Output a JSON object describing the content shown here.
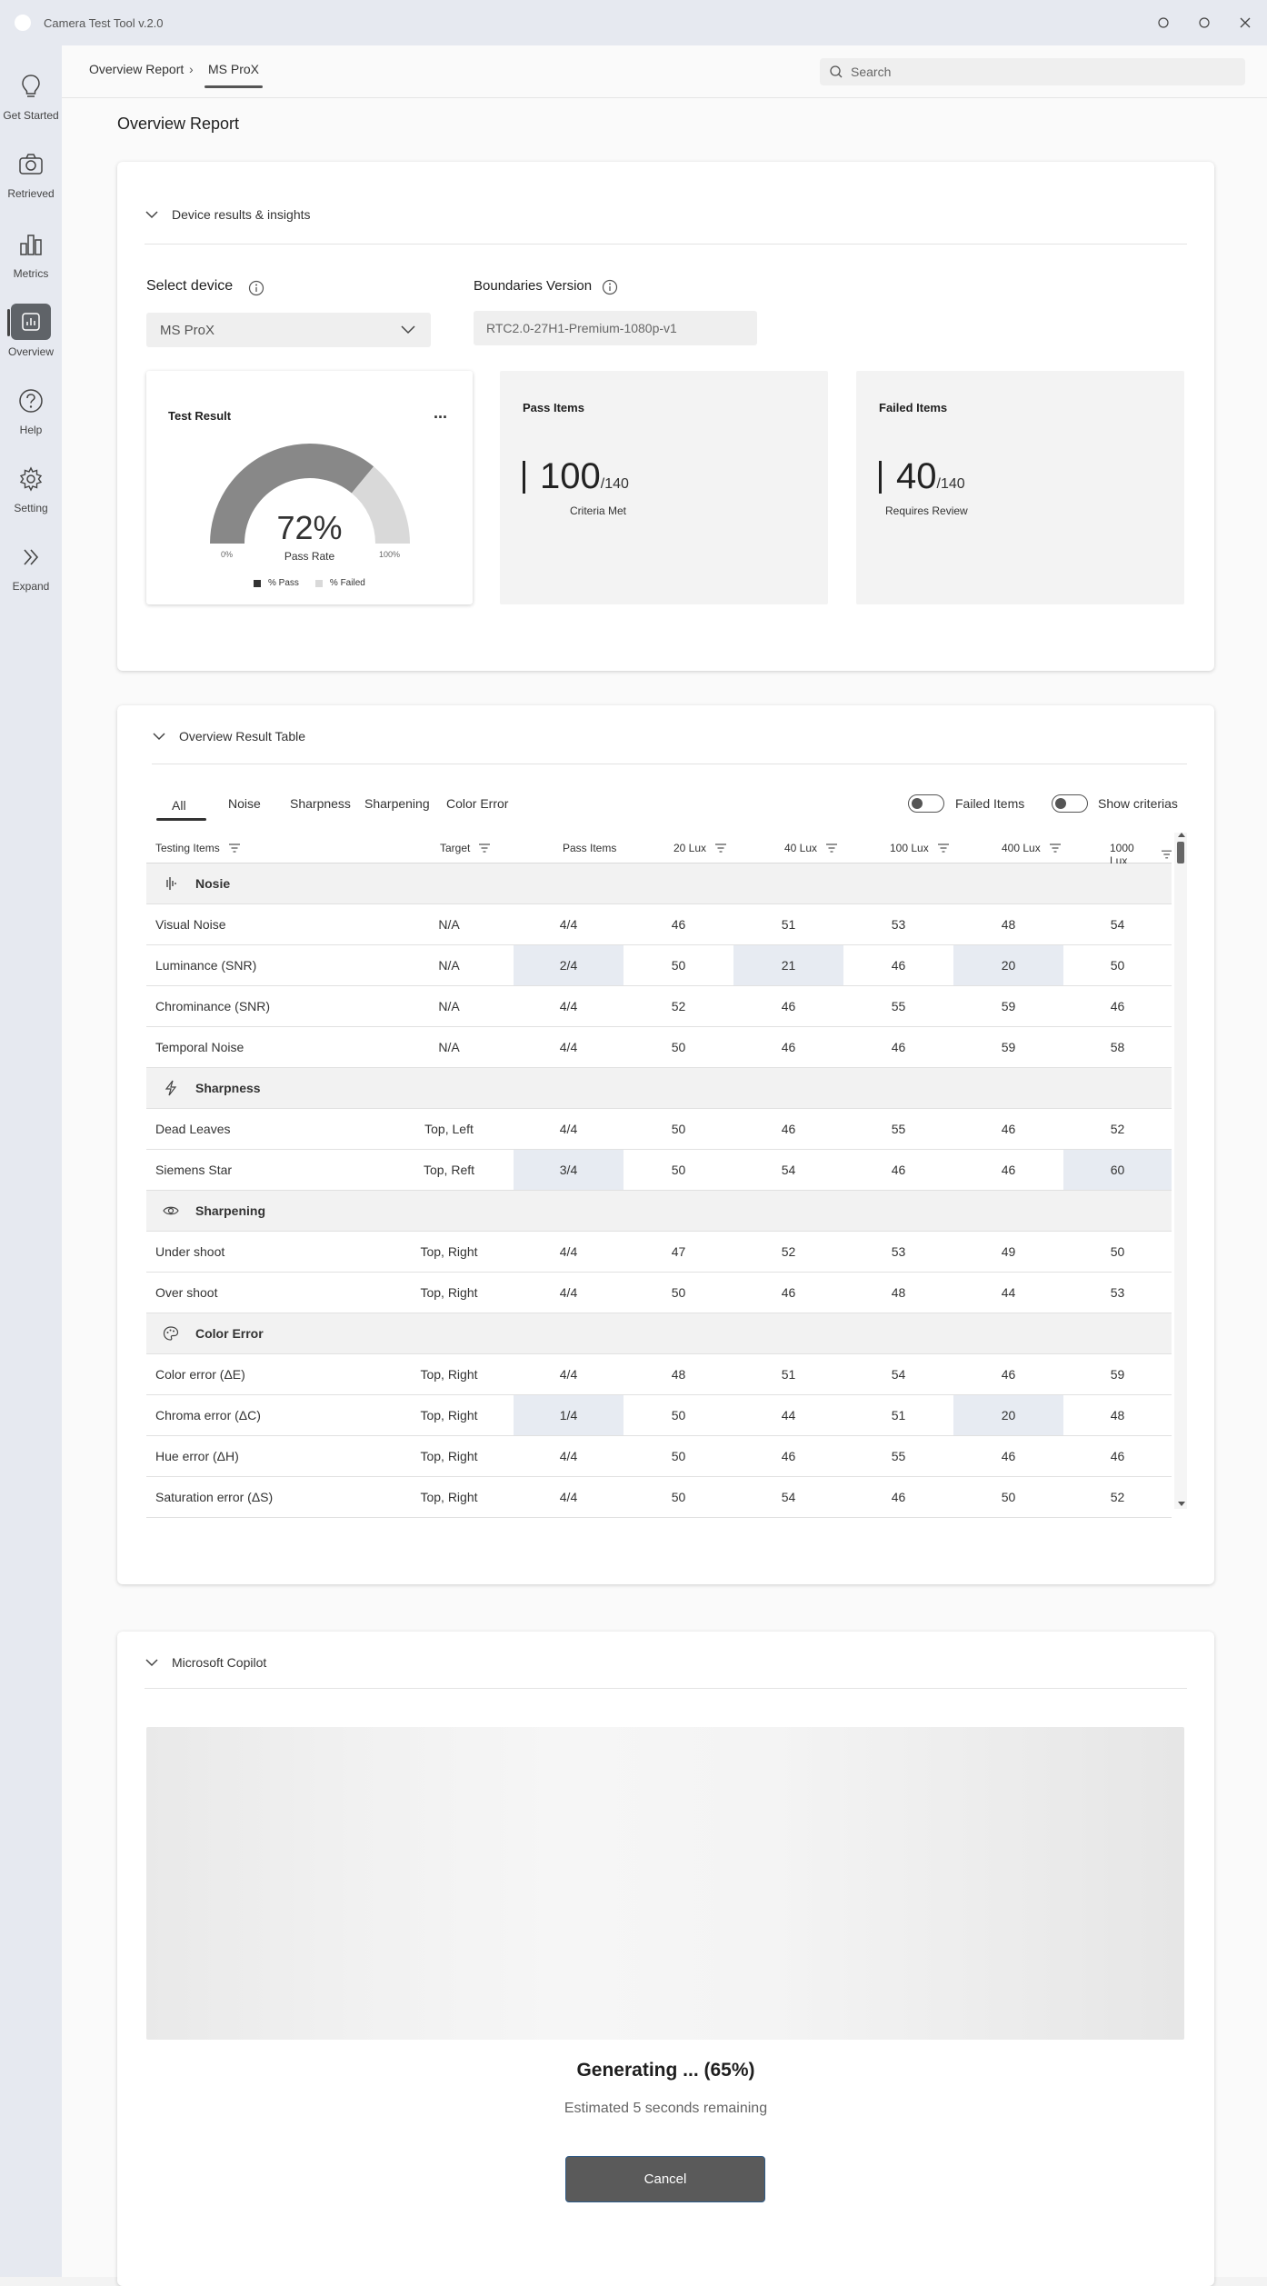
{
  "window": {
    "title": "Camera Test Tool v.2.0"
  },
  "rail": [
    {
      "label": "Get Started",
      "icon": "lightbulb-icon"
    },
    {
      "label": "Retrieved",
      "icon": "camera-icon"
    },
    {
      "label": "Metrics",
      "icon": "bar-chart-icon"
    },
    {
      "label": "Overview",
      "icon": "report-icon"
    },
    {
      "label": "Help",
      "icon": "help-icon"
    },
    {
      "label": "Setting",
      "icon": "gear-icon"
    },
    {
      "label": "Expand",
      "icon": "double-chevron-right-icon"
    }
  ],
  "rail_active": "Overview",
  "breadcrumb": {
    "root": "Overview Report",
    "current": "MS ProX"
  },
  "search": {
    "placeholder": "Search"
  },
  "page_title": "Overview Report",
  "insights": {
    "section_title": "Device results & insights",
    "select_device_label": "Select device",
    "device_value": "MS ProX",
    "boundaries_label": "Boundaries Version",
    "boundaries_value": "RTC2.0-27H1-Premium-1080p-v1",
    "test_result": {
      "title": "Test Result",
      "more": "...",
      "pass_rate_percent": 72,
      "pass_rate_text": "72%",
      "pass_rate_label": "Pass Rate",
      "min_label": "0%",
      "max_label": "100%",
      "legend_pass": "% Pass",
      "legend_failed": "% Failed",
      "pass_color": "#888888",
      "failed_color": "#d9d9d9"
    },
    "pass_items": {
      "title": "Pass Items",
      "value": "100",
      "total": "/140",
      "caption": "Criteria Met"
    },
    "failed_items": {
      "title": "Failed Items",
      "value": "40",
      "total": "/140",
      "caption": "Requires Review"
    }
  },
  "table": {
    "section_title": "Overview Result Table",
    "tabs": [
      "All",
      "Noise",
      "Sharpness",
      "Sharpening",
      "Color Error"
    ],
    "active_tab": "All",
    "toggles": [
      {
        "label": "Failed Items",
        "on": false
      },
      {
        "label": "Show criterias",
        "on": false
      }
    ],
    "columns": [
      "Testing Items",
      "Target",
      "Pass Items",
      "20 Lux",
      "40 Lux",
      "100 Lux",
      "400 Lux",
      "1000 Lux"
    ],
    "highlight_color": "#e7ebf2",
    "rows": [
      {
        "group": "Nosie",
        "icon": "waveform-icon"
      },
      {
        "cells": [
          "Visual Noise",
          "N/A",
          "4/4",
          "46",
          "51",
          "53",
          "48",
          "54"
        ],
        "hl": []
      },
      {
        "cells": [
          "Luminance (SNR)",
          "N/A",
          "2/4",
          "50",
          "21",
          "46",
          "20",
          "50"
        ],
        "hl": [
          2,
          4,
          6
        ]
      },
      {
        "cells": [
          "Chrominance (SNR)",
          "N/A",
          "4/4",
          "52",
          "46",
          "55",
          "59",
          "46"
        ],
        "hl": []
      },
      {
        "cells": [
          "Temporal Noise",
          "N/A",
          "4/4",
          "50",
          "46",
          "46",
          "59",
          "58"
        ],
        "hl": []
      },
      {
        "group": "Sharpness",
        "icon": "bolt-icon"
      },
      {
        "cells": [
          "Dead Leaves",
          "Top, Left",
          "4/4",
          "50",
          "46",
          "55",
          "46",
          "52"
        ],
        "hl": []
      },
      {
        "cells": [
          "Siemens Star",
          "Top, Reft",
          "3/4",
          "50",
          "54",
          "46",
          "46",
          "60"
        ],
        "hl": [
          2,
          7
        ]
      },
      {
        "group": "Sharpening",
        "icon": "eye-icon"
      },
      {
        "cells": [
          "Under shoot",
          "Top, Right",
          "4/4",
          "47",
          "52",
          "53",
          "49",
          "50"
        ],
        "hl": []
      },
      {
        "cells": [
          "Over shoot",
          "Top, Right",
          "4/4",
          "50",
          "46",
          "48",
          "44",
          "53"
        ],
        "hl": []
      },
      {
        "group": "Color Error",
        "icon": "palette-icon"
      },
      {
        "cells": [
          "Color error (ΔE)",
          "Top, Right",
          "4/4",
          "48",
          "51",
          "54",
          "46",
          "59"
        ],
        "hl": []
      },
      {
        "cells": [
          "Chroma error (ΔC)",
          "Top, Right",
          "1/4",
          "50",
          "44",
          "51",
          "20",
          "48"
        ],
        "hl": [
          2,
          6
        ]
      },
      {
        "cells": [
          "Hue error (ΔH)",
          "Top, Right",
          "4/4",
          "50",
          "46",
          "55",
          "46",
          "46"
        ],
        "hl": []
      },
      {
        "cells": [
          "Saturation error (ΔS)",
          "Top, Right",
          "4/4",
          "50",
          "54",
          "46",
          "50",
          "52"
        ],
        "hl": []
      }
    ]
  },
  "copilot": {
    "section_title": "Microsoft Copilot",
    "generating_text": "Generating ... (65%)",
    "progress_percent": 65,
    "estimate_text": "Estimated 5 seconds remaining",
    "cancel_label": "Cancel"
  }
}
